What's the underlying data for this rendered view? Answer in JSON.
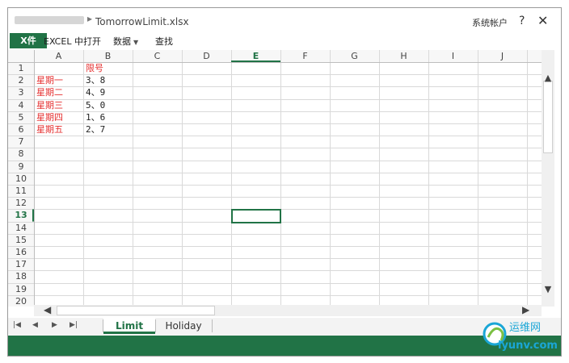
{
  "titlebar": {
    "filename": "TomorrowLimit.xlsx",
    "breadcrumb_sep": "▸",
    "account": "系统帐户",
    "help": "?",
    "close": "✕"
  },
  "ribbon": {
    "file_tab": "X件",
    "open_in_excel": "EXCEL 中打开",
    "data": "数据",
    "find": "查找"
  },
  "columns": [
    "A",
    "B",
    "C",
    "D",
    "E",
    "F",
    "G",
    "H",
    "I",
    "J"
  ],
  "selected_column": "E",
  "rows": [
    "1",
    "2",
    "3",
    "4",
    "5",
    "6",
    "7",
    "8",
    "9",
    "10",
    "11",
    "12",
    "13",
    "14",
    "15",
    "16",
    "17",
    "18",
    "19",
    "20"
  ],
  "selected_row": "13",
  "cells": {
    "B1": "限号",
    "A2": "星期一",
    "B2": "3、8",
    "A3": "星期二",
    "B3": "4、9",
    "A4": "星期三",
    "B4": "5、0",
    "A5": "星期四",
    "B5": "1、6",
    "A6": "星期五",
    "B6": "2、7"
  },
  "scroll": {
    "up": "▲",
    "down": "▼",
    "left": "◀",
    "right": "▶"
  },
  "sheet_nav": {
    "first": "|◀",
    "prev": "◀",
    "next": "▶",
    "last": "▶|"
  },
  "sheets": [
    "Limit",
    "Holiday"
  ],
  "active_sheet": "Limit",
  "watermark": {
    "line1": "运维网",
    "line2": "iyunv.com"
  },
  "colors": {
    "accent": "#217346",
    "cell_text": "#e53030"
  }
}
